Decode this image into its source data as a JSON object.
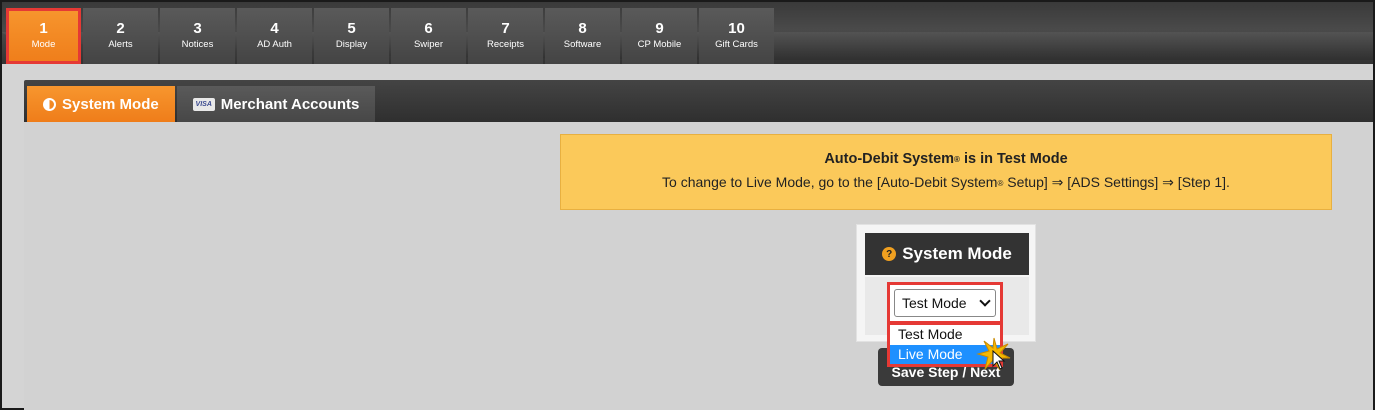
{
  "steps": [
    {
      "num": "1",
      "label": "Mode"
    },
    {
      "num": "2",
      "label": "Alerts"
    },
    {
      "num": "3",
      "label": "Notices"
    },
    {
      "num": "4",
      "label": "AD Auth"
    },
    {
      "num": "5",
      "label": "Display"
    },
    {
      "num": "6",
      "label": "Swiper"
    },
    {
      "num": "7",
      "label": "Receipts"
    },
    {
      "num": "8",
      "label": "Software"
    },
    {
      "num": "9",
      "label": "CP Mobile"
    },
    {
      "num": "10",
      "label": "Gift Cards"
    }
  ],
  "subtabs": {
    "system_mode": "System Mode",
    "merchant_accounts": "Merchant Accounts",
    "visa_text": "VISA"
  },
  "notice": {
    "title_pre": "Auto-Debit System",
    "title_reg": "®",
    "title_post": " is in Test Mode",
    "body_pre": "To change to Live Mode, go to the [Auto-Debit System",
    "body_reg": "®",
    "body_post": " Setup] ⇒ [ADS Settings] ⇒ [Step 1]."
  },
  "mode_box": {
    "title": "System Mode",
    "help_glyph": "?",
    "selected_value": "Test Mode",
    "options": [
      "Test Mode",
      "Live Mode"
    ],
    "highlighted_option": "Live Mode"
  },
  "save_button": "Save Step / Next",
  "colors": {
    "accent": "#ef7d1a",
    "notice_bg": "#fbc95a",
    "highlight_box": "#e53935",
    "option_selected": "#1e90ff"
  }
}
